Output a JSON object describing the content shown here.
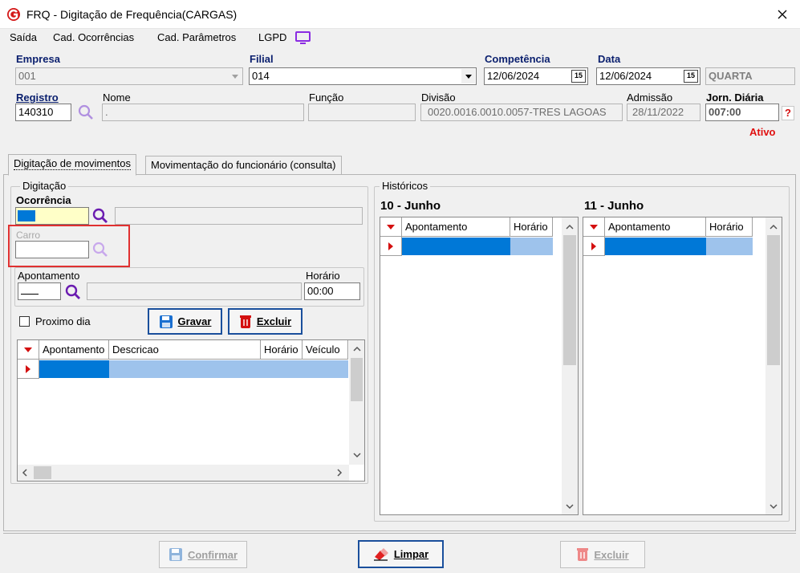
{
  "window": {
    "title": "FRQ - Digitação de Frequência(CARGAS)"
  },
  "menu": [
    "Saída",
    "Cad. Ocorrências",
    "Cad. Parâmetros",
    "LGPD"
  ],
  "header": {
    "empresa_label": "Empresa",
    "empresa_value": "001",
    "filial_label": "Filial",
    "filial_value": "014",
    "competencia_label": "Competência",
    "competencia_value": "12/06/2024",
    "data_label": "Data",
    "data_value": "12/06/2024",
    "weekday": "QUARTA",
    "registro_label": "Registro",
    "registro_value": "140310",
    "nome_label": "Nome",
    "nome_value": ".",
    "funcao_label": "Função",
    "funcao_value": "",
    "divisao_label": "Divisão",
    "divisao_value": "0020.0016.0010.0057-TRES LAGOAS",
    "admissao_label": "Admissão",
    "admissao_value": "28/11/2022",
    "jornada_label": "Jorn. Diária",
    "jornada_value": "007:00",
    "help": "?",
    "status": "Ativo",
    "cal_icon_text": "15"
  },
  "tabs": [
    "Digitação de movimentos",
    "Movimentação do funcionário (consulta)"
  ],
  "digitacao": {
    "group_title": "Digitação",
    "ocorrencia_label": "Ocorrência",
    "carro_label": "Carro",
    "apontamento_label": "Apontamento",
    "horario_label": "Horário",
    "horario_value": "00:00",
    "proximo_dia_label": "Proximo dia",
    "gravar_label": "Gravar",
    "excluir_label": "Excluir",
    "grid_columns": [
      "Apontamento",
      "Descricao",
      "Horário",
      "Veículo"
    ]
  },
  "historicos": {
    "group_title": "Históricos",
    "day1_title": "10 - Junho",
    "day2_title": "11 - Junho",
    "columns": [
      "Apontamento",
      "Horário"
    ]
  },
  "footer": {
    "confirmar_label": "Confirmar",
    "limpar_label": "Limpar",
    "excluir_label": "Excluir"
  },
  "colors": {
    "accent_blue": "#0a1f6e",
    "selection_blue": "#0078d7",
    "selection_light": "#9ec3ec",
    "status_red": "#e01010",
    "highlight_box": "#e03030",
    "search_purple": "#8a2be2"
  }
}
